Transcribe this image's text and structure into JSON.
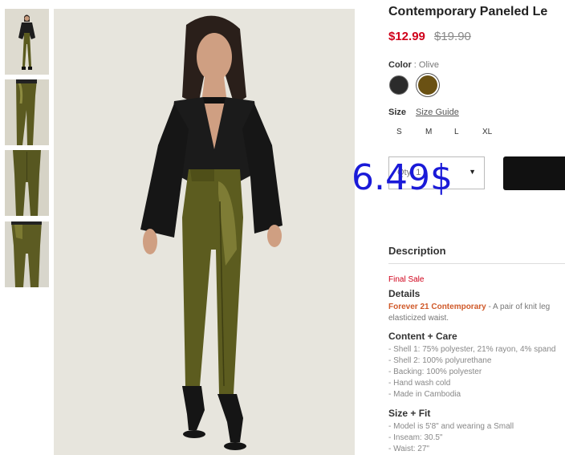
{
  "product": {
    "title": "Contemporary Paneled Le",
    "sale_price": "$12.99",
    "original_price": "$19.90"
  },
  "color": {
    "label": "Color",
    "separator": ":",
    "selected": "Olive",
    "swatches": [
      {
        "name": "Black",
        "hex": "#2b2b2b"
      },
      {
        "name": "Olive",
        "hex": "#6a5113"
      }
    ]
  },
  "size": {
    "label": "Size",
    "guide_link": "Size Guide",
    "options": [
      "S",
      "M",
      "L",
      "XL"
    ]
  },
  "quantity": {
    "value": "Qty: 1"
  },
  "overlay_price": "6.49$",
  "description": {
    "heading": "Description",
    "final_sale": "Final Sale",
    "details_heading": "Details",
    "brand": "Forever 21 Contemporary",
    "details_text": " - A pair of knit leg",
    "details_text_2": "elasticized waist.",
    "content_heading": "Content + Care",
    "content_items": [
      "- Shell 1: 75% polyester, 21% rayon, 4% spand",
      "- Shell 2: 100% polyurethane",
      "- Backing: 100% polyester",
      "- Hand wash cold",
      "- Made in Cambodia"
    ],
    "fit_heading": "Size + Fit",
    "fit_items": [
      "- Model is 5'8\" and wearing a Small",
      "- Inseam: 30.5\"",
      "- Waist: 27\""
    ]
  },
  "colors": {
    "sale_red": "#d0021b",
    "brand_orange": "#d05a2a",
    "overlay_blue": "#1a1ad8",
    "button_black": "#111111"
  }
}
